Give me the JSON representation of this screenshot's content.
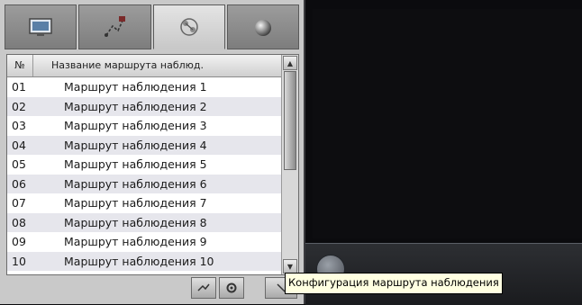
{
  "tabs": [
    {
      "icon": "monitor-icon"
    },
    {
      "icon": "route-map-icon"
    },
    {
      "icon": "route-config-icon"
    },
    {
      "icon": "ball-icon"
    }
  ],
  "table": {
    "headers": {
      "num": "№",
      "name": "Название маршрута наблюд."
    },
    "rows": [
      {
        "num": "01",
        "name": "Маршрут наблюдения  1"
      },
      {
        "num": "02",
        "name": "Маршрут наблюдения  2"
      },
      {
        "num": "03",
        "name": "Маршрут наблюдения  3"
      },
      {
        "num": "04",
        "name": "Маршрут наблюдения  4"
      },
      {
        "num": "05",
        "name": "Маршрут наблюдения  5"
      },
      {
        "num": "06",
        "name": "Маршрут наблюдения  6"
      },
      {
        "num": "07",
        "name": "Маршрут наблюдения  7"
      },
      {
        "num": "08",
        "name": "Маршрут наблюдения  8"
      },
      {
        "num": "09",
        "name": "Маршрут наблюдения  9"
      },
      {
        "num": "10",
        "name": "Маршрут наблюдения  10"
      }
    ]
  },
  "bottom_buttons": [
    {
      "icon": "edit-route-icon"
    },
    {
      "icon": "settings-gear-icon"
    },
    {
      "icon": "config-icon"
    }
  ],
  "tooltip": "Конфигурация маршрута наблюдения"
}
